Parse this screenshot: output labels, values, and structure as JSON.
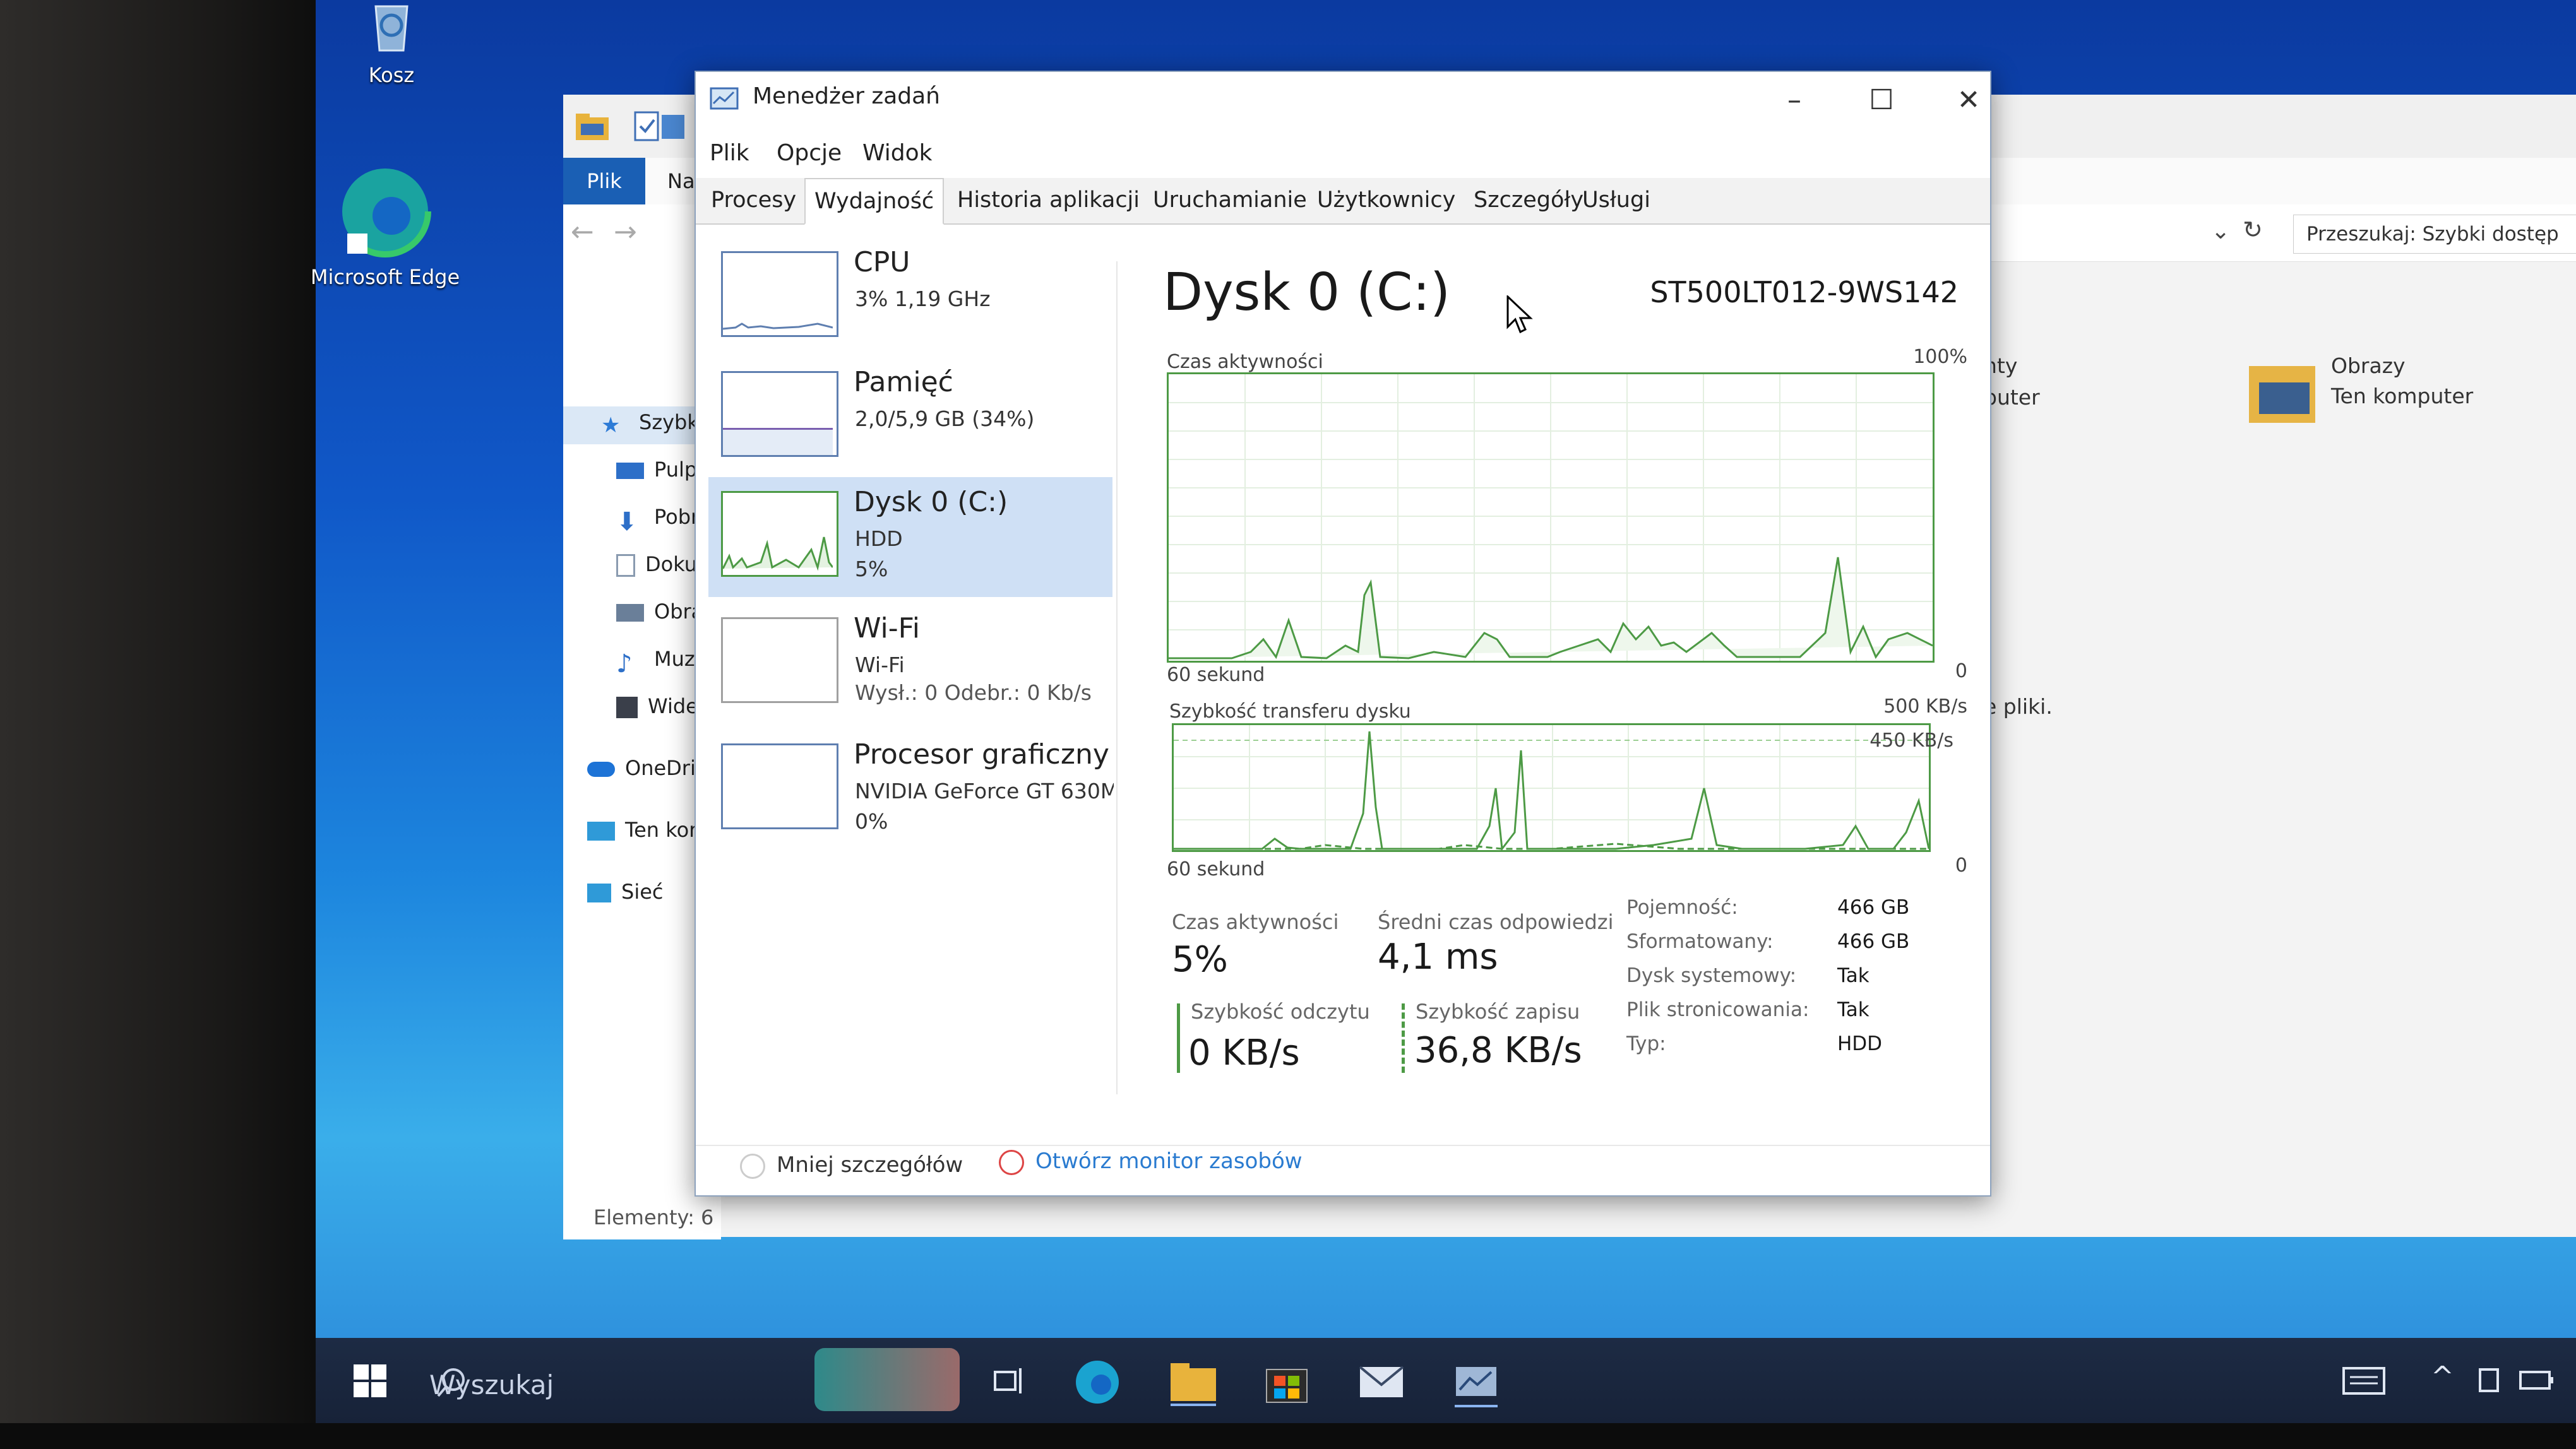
{
  "desktop": {
    "icons": [
      {
        "label": "Kosz",
        "icon": "recycle-bin-icon"
      },
      {
        "label": "Microsoft Edge",
        "icon": "edge-icon"
      }
    ]
  },
  "explorer": {
    "tabs": [
      "Plik",
      "Na"
    ],
    "search_placeholder": "Przeszukaj: Szybki dostęp",
    "sidebar": [
      {
        "label": "Szybki",
        "icon": "star-icon"
      },
      {
        "label": "Pulpi",
        "icon": "desktop-folder-icon"
      },
      {
        "label": "Pobra",
        "icon": "download-icon"
      },
      {
        "label": "Doku",
        "icon": "document-icon"
      },
      {
        "label": "Obraz",
        "icon": "pictures-icon"
      },
      {
        "label": "Muzy",
        "icon": "music-icon"
      },
      {
        "label": "Wide",
        "icon": "video-icon"
      },
      {
        "label": "OneDri",
        "icon": "cloud-icon"
      },
      {
        "label": "Ten kor",
        "icon": "computer-icon"
      },
      {
        "label": "Sieć",
        "icon": "network-icon"
      }
    ],
    "status": "Elementy: 6",
    "content": {
      "partial1": "nty",
      "partial2": "puter",
      "partial3": "e pliki.",
      "folder_name": "Obrazy",
      "folder_location": "Ten komputer"
    }
  },
  "taskmgr": {
    "title": "Menedżer zadań",
    "menu": [
      "Plik",
      "Opcje",
      "Widok"
    ],
    "tabs": [
      "Procesy",
      "Wydajność",
      "Historia aplikacji",
      "Uruchamianie",
      "Użytkownicy",
      "Szczegóły",
      "Usługi"
    ],
    "active_tab": "Wydajność",
    "perf_items": [
      {
        "name": "CPU",
        "line1": "3% 1,19 GHz",
        "line2": ""
      },
      {
        "name": "Pamięć",
        "line1": "2,0/5,9 GB (34%)",
        "line2": ""
      },
      {
        "name": "Dysk 0 (C:)",
        "line1": "HDD",
        "line2": "5%"
      },
      {
        "name": "Wi-Fi",
        "line1": "Wi-Fi",
        "line2": "Wysł.: 0 Odebr.: 0 Kb/s"
      },
      {
        "name": "Procesor graficzny",
        "line1": "NVIDIA GeForce GT 630M",
        "line2": "0%"
      }
    ],
    "detail": {
      "title": "Dysk 0 (C:)",
      "model": "ST500LT012-9WS142",
      "graph1_label": "Czas aktywności",
      "graph1_max": "100%",
      "graph1_time": "60 sekund",
      "graph1_min": "0",
      "graph2_label": "Szybkość transferu dysku",
      "graph2_max": "500 KB/s",
      "graph2_mark": "450 KB/s",
      "graph2_time": "60 sekund",
      "graph2_min": "0",
      "stats": {
        "active_label": "Czas aktywności",
        "active_value": "5%",
        "resp_label": "Średni czas odpowiedzi",
        "resp_value": "4,1 ms",
        "read_label": "Szybkość odczytu",
        "read_value": "0 KB/s",
        "write_label": "Szybkość zapisu",
        "write_value": "36,8 KB/s"
      },
      "props": [
        {
          "key": "Pojemność:",
          "value": "466 GB"
        },
        {
          "key": "Sformatowany:",
          "value": "466 GB"
        },
        {
          "key": "Dysk systemowy:",
          "value": "Tak"
        },
        {
          "key": "Plik stronicowania:",
          "value": "Tak"
        },
        {
          "key": "Typ:",
          "value": "HDD"
        }
      ]
    },
    "footer": {
      "fewer": "Mniej szczegółów",
      "monitor": "Otwórz monitor zasobów"
    }
  },
  "taskbar": {
    "search_placeholder": "Wyszukaj"
  },
  "colors": {
    "accent": "#1a5fb4",
    "graph_line": "#4d9a45",
    "selection": "#cfe0f5"
  }
}
